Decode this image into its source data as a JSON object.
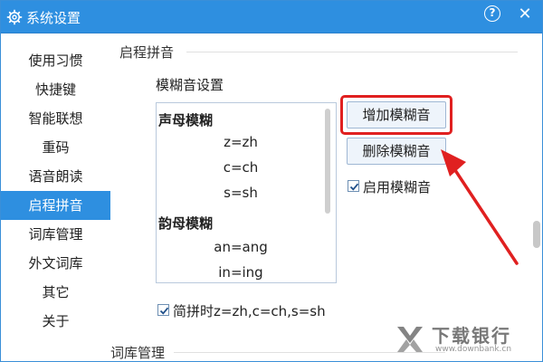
{
  "window": {
    "title": "系统设置"
  },
  "titlebar": {
    "help_label": "?",
    "close_label": "✕"
  },
  "sidebar": {
    "items": [
      {
        "label": "使用习惯"
      },
      {
        "label": "快捷键"
      },
      {
        "label": "智能联想"
      },
      {
        "label": "重码"
      },
      {
        "label": "语音朗读"
      },
      {
        "label": "启程拼音",
        "active": true
      },
      {
        "label": "词库管理"
      },
      {
        "label": "外文词库"
      },
      {
        "label": "其它"
      },
      {
        "label": "关于"
      }
    ]
  },
  "content": {
    "section_title": "启程拼音",
    "fuzzy": {
      "label": "模糊音设置",
      "list": {
        "initials_heading": "声母模糊",
        "initials": [
          "z=zh",
          "c=ch",
          "s=sh"
        ],
        "finals_heading": "韵母模糊",
        "finals": [
          "an=ang",
          "in=ing"
        ]
      },
      "add_button": "增加模糊音",
      "delete_button": "删除模糊音",
      "enable_label": "启用模糊音",
      "enable_checked": true
    },
    "shorthand_label": "简拼时z=zh,c=ch,s=sh",
    "shorthand_checked": true,
    "next_section_title": "词库管理"
  },
  "watermark": {
    "brand": "下载银行",
    "url": "www.downbank.cn"
  },
  "colors": {
    "accent": "#2e8fe0",
    "highlight": "#e02020"
  }
}
